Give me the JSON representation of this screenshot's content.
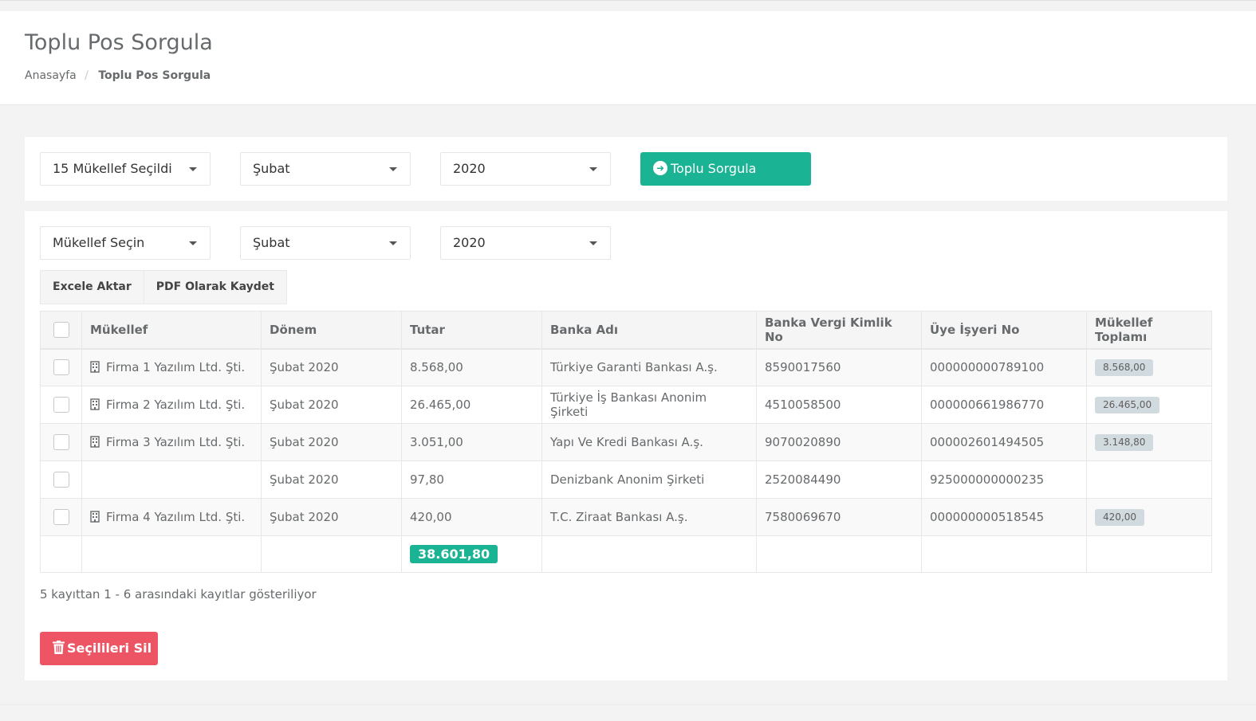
{
  "header": {
    "title": "Toplu Pos Sorgula",
    "breadcrumb": {
      "home": "Anasayfa",
      "separator": "/",
      "current": "Toplu Pos Sorgula"
    }
  },
  "top_filters": {
    "taxpayer_select": "15 Mükellef Seçildi",
    "month_select": "Şubat",
    "year_select": "2020",
    "query_button": "Toplu Sorgula"
  },
  "main_filters": {
    "taxpayer_select": "Mükellef Seçin",
    "month_select": "Şubat",
    "year_select": "2020"
  },
  "export_buttons": {
    "excel": "Excele Aktar",
    "pdf": "PDF Olarak Kaydet"
  },
  "table": {
    "columns": [
      "Mükellef",
      "Dönem",
      "Tutar",
      "Banka Adı",
      "Banka Vergi Kimlik No",
      "Üye İşyeri No",
      "Mükellef Toplamı"
    ],
    "rows": [
      {
        "company": "Firma 1 Yazılım Ltd. Şti.",
        "period": "Şubat 2020",
        "amount": "8.568,00",
        "bank": "Türkiye Garanti Bankası A.ş.",
        "tax_no": "8590017560",
        "merchant_no": "000000000789100",
        "total": "8.568,00"
      },
      {
        "company": "Firma 2 Yazılım Ltd. Şti.",
        "period": "Şubat 2020",
        "amount": "26.465,00",
        "bank": "Türkiye İş Bankası Anonim Şirketi",
        "tax_no": "4510058500",
        "merchant_no": "000000661986770",
        "total": "26.465,00"
      },
      {
        "company": "Firma 3 Yazılım Ltd. Şti.",
        "period": "Şubat 2020",
        "amount": "3.051,00",
        "bank": "Yapı Ve Kredi Bankası A.ş.",
        "tax_no": "9070020890",
        "merchant_no": "000002601494505",
        "total": "3.148,80"
      },
      {
        "company": "",
        "period": "Şubat 2020",
        "amount": "97,80",
        "bank": "Denizbank Anonim Şirketi",
        "tax_no": "2520084490",
        "merchant_no": "925000000000235",
        "total": ""
      },
      {
        "company": "Firma 4 Yazılım Ltd. Şti.",
        "period": "Şubat 2020",
        "amount": "420,00",
        "bank": "T.C. Ziraat Bankası A.ş.",
        "tax_no": "7580069670",
        "merchant_no": "000000000518545",
        "total": "420,00"
      }
    ],
    "grand_total": "38.601,80"
  },
  "info_text": "5 kayıttan 1 - 6 arasındaki kayıtlar gösteriliyor",
  "delete_button": "Seçilileri Sil",
  "colors": {
    "primary": "#1ab394",
    "danger": "#ed5565",
    "total_row": "#ffffcc",
    "label_gray": "#d1dade"
  },
  "icons": {
    "query": "arrow-circle-right-icon",
    "company": "building-icon",
    "delete": "trash-icon",
    "dropdown": "caret-down-icon"
  }
}
